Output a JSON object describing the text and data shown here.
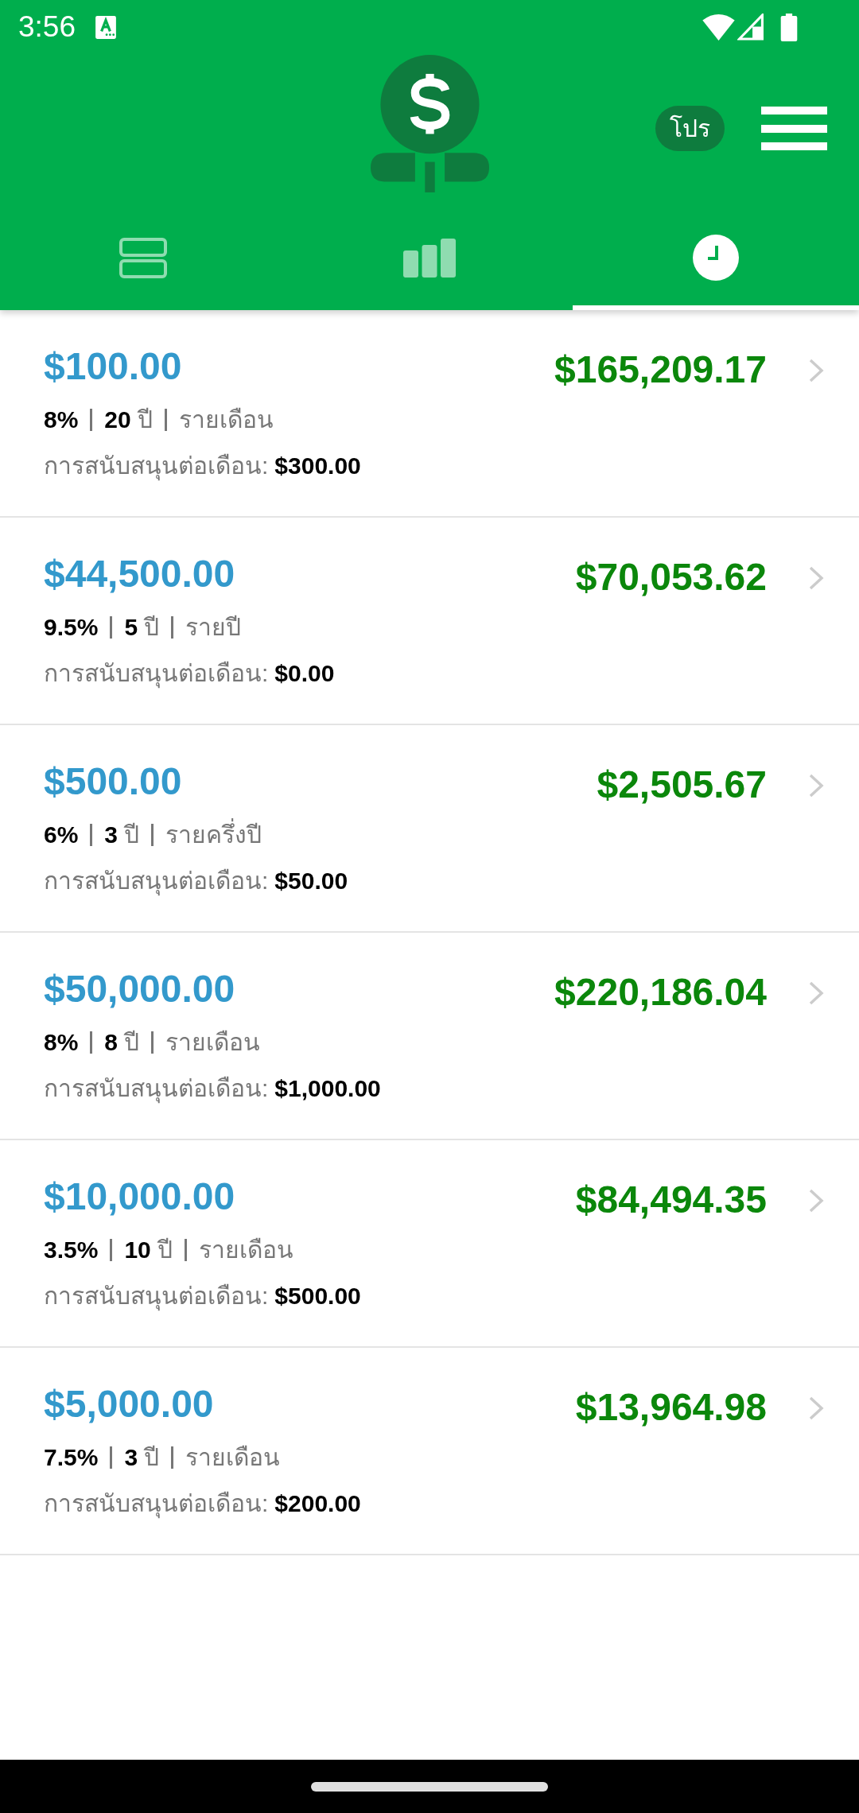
{
  "status_bar": {
    "time": "3:56"
  },
  "header": {
    "pro_badge": "โปร"
  },
  "tabs": [
    {
      "selected": false
    },
    {
      "selected": false
    },
    {
      "selected": true
    }
  ],
  "investments": [
    {
      "principal": "$100.00",
      "future_value": "$165,209.17",
      "rate": "8%",
      "term": "**20** ปี",
      "frequency": "รายเดือน",
      "contribution_label": "การสนับสนุนต่อเดือน:",
      "contribution": "$300.00"
    },
    {
      "principal": "$44,500.00",
      "future_value": "$70,053.62",
      "rate": "9.5%",
      "term": "**5** ปี",
      "frequency": "รายปี",
      "contribution_label": "การสนับสนุนต่อเดือน:",
      "contribution": "$0.00"
    },
    {
      "principal": "$500.00",
      "future_value": "$2,505.67",
      "rate": "6%",
      "term": "**3** ปี",
      "frequency": "รายครึ่งปี",
      "contribution_label": "การสนับสนุนต่อเดือน:",
      "contribution": "$50.00"
    },
    {
      "principal": "$50,000.00",
      "future_value": "$220,186.04",
      "rate": "8%",
      "term": "**8** ปี",
      "frequency": "รายเดือน",
      "contribution_label": "การสนับสนุนต่อเดือน:",
      "contribution": "$1,000.00"
    },
    {
      "principal": "$10,000.00",
      "future_value": "$84,494.35",
      "rate": "3.5%",
      "term": "**10** ปี",
      "frequency": "รายเดือน",
      "contribution_label": "การสนับสนุนต่อเดือน:",
      "contribution": "$500.00"
    },
    {
      "principal": "$5,000.00",
      "future_value": "$13,964.98",
      "rate": "7.5%",
      "term": "**3** ปี",
      "frequency": "รายเดือน",
      "contribution_label": "การสนับสนุนต่อเดือน:",
      "contribution": "$200.00"
    }
  ]
}
